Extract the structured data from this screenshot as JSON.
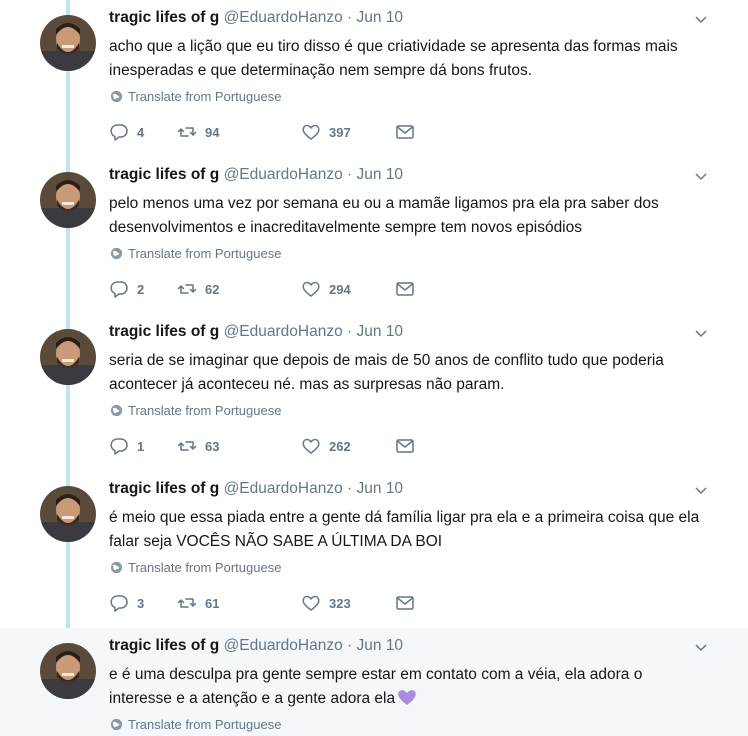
{
  "author": {
    "name": "tragic lifes of g",
    "handle": "@EduardoHanzo",
    "separator": "·"
  },
  "translate_label": "Translate from Portuguese",
  "tweets": [
    {
      "date": "Jun 10",
      "text": "acho que a lição que eu tiro disso é que criatividade se apresenta das formas mais inesperadas e que determinação nem sempre dá bons frutos.",
      "replies": "4",
      "retweets": "94",
      "likes": "397"
    },
    {
      "date": "Jun 10",
      "text": "pelo menos uma vez por semana eu ou a mamãe ligamos pra ela pra saber dos desenvolvimentos e inacreditavelmente sempre tem novos episódios",
      "replies": "2",
      "retweets": "62",
      "likes": "294"
    },
    {
      "date": "Jun 10",
      "text": "seria de se imaginar que depois de mais de 50 anos de conflito tudo que poderia acontecer já aconteceu né. mas as surpresas não param.",
      "replies": "1",
      "retweets": "63",
      "likes": "262"
    },
    {
      "date": "Jun 10",
      "text": "é meio que essa piada entre a gente dá família ligar pra ela e a primeira coisa que ela falar seja VOCÊS NÃO SABE A ÚLTIMA DA BOI",
      "replies": "3",
      "retweets": "61",
      "likes": "323"
    },
    {
      "date": "Jun 10",
      "text": "e é uma desculpa pra gente sempre estar em contato com a véia, ela adora o interesse e a atenção e a gente adora ela"
    }
  ],
  "colors": {
    "thread_line": "#c2e3f5",
    "secondary_text": "#657786",
    "primary_text": "#14171a",
    "highlight_bg": "#f5f8fa",
    "purple_heart": "#a98ce0"
  },
  "icons": {
    "reply": "reply-icon",
    "retweet": "retweet-icon",
    "like": "heart-icon",
    "dm": "envelope-icon",
    "translate": "globe-icon",
    "menu": "chevron-down-icon"
  }
}
